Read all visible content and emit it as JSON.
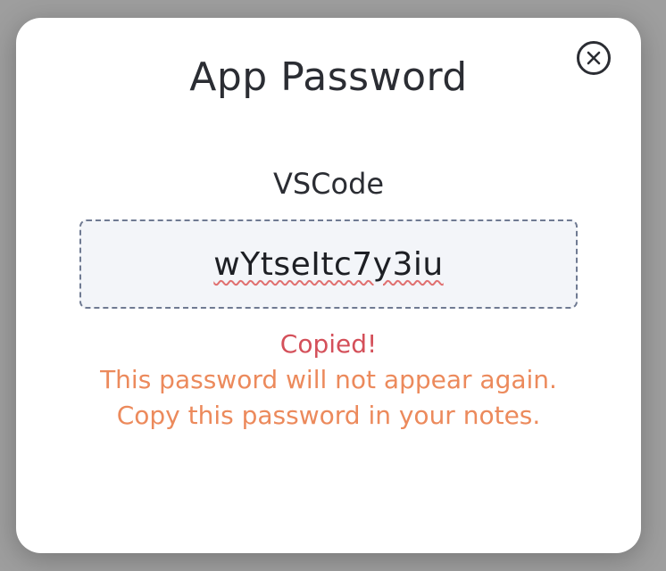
{
  "modal": {
    "title": "App Password",
    "close_icon": "close-circle-icon",
    "app_name": "VSCode",
    "password": "wYtseItc7y3iu",
    "status_text": "Copied!",
    "warning_line_1": "This password will not appear again.",
    "warning_line_2": "Copy this password in your notes."
  },
  "colors": {
    "status": "#d4505a",
    "warning": "#ec8a5c",
    "box_border": "#6f7a92",
    "box_background": "#f3f5f9"
  }
}
